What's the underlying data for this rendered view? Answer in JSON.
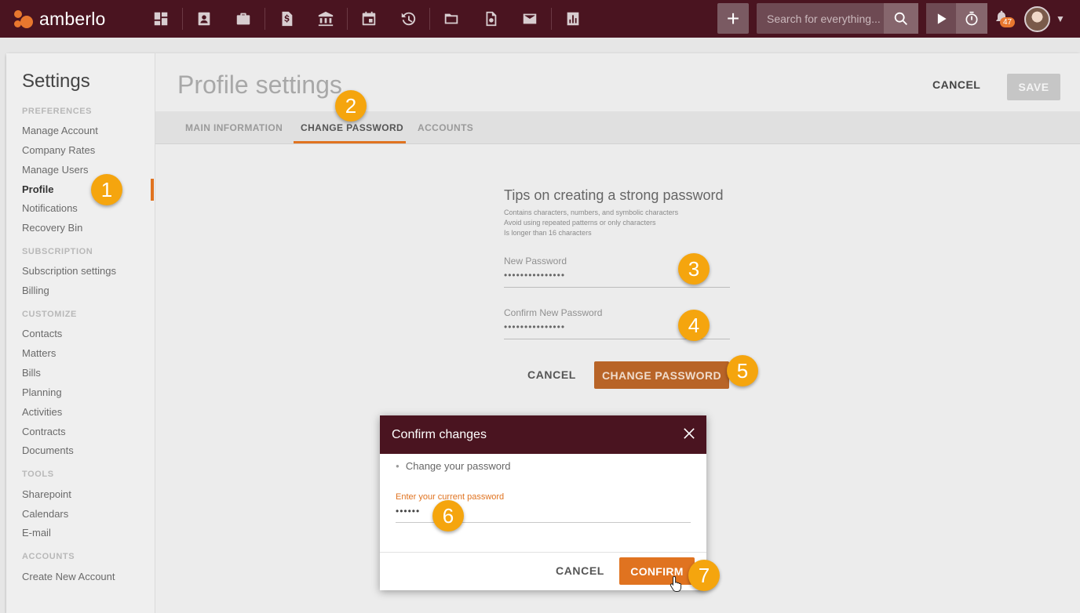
{
  "app": {
    "name": "amberlo"
  },
  "topbar": {
    "nav_icons": [
      "dashboard-icon",
      "contacts-icon",
      "matters-icon",
      "bills-icon",
      "bank-icon",
      "calendar-icon",
      "time-history-icon",
      "folder-icon",
      "document-settings-icon",
      "mail-icon",
      "reports-icon"
    ],
    "add_label": "+",
    "search_placeholder": "Search for everything...",
    "notifications_count": "47"
  },
  "sidebar": {
    "title": "Settings",
    "sections": [
      {
        "label": "PREFERENCES",
        "items": [
          "Manage Account",
          "Company Rates",
          "Manage Users",
          "Profile",
          "Notifications",
          "Recovery Bin"
        ]
      },
      {
        "label": "SUBSCRIPTION",
        "items": [
          "Subscription settings",
          "Billing"
        ]
      },
      {
        "label": "CUSTOMIZE",
        "items": [
          "Contacts",
          "Matters",
          "Bills",
          "Planning",
          "Activities",
          "Contracts",
          "Documents"
        ]
      },
      {
        "label": "TOOLS",
        "items": [
          "Sharepoint",
          "Calendars",
          "E-mail"
        ]
      },
      {
        "label": "ACCOUNTS",
        "items": [
          "Create New Account"
        ]
      }
    ],
    "active_item": "Profile"
  },
  "header": {
    "title": "Profile settings",
    "cancel_label": "CANCEL",
    "save_label": "SAVE"
  },
  "tabs": [
    {
      "label": "MAIN INFORMATION",
      "active": false
    },
    {
      "label": "CHANGE PASSWORD",
      "active": true
    },
    {
      "label": "ACCOUNTS",
      "active": false
    }
  ],
  "password_form": {
    "tips_title": "Tips on creating a strong password",
    "tips": [
      "Contains characters, numbers, and symbolic characters",
      "Avoid using repeated patterns or only characters",
      "Is longer than 16 characters"
    ],
    "new_password_label": "New Password",
    "new_password_value": "•••••••••••••••",
    "confirm_password_label": "Confirm New Password",
    "confirm_password_value": "•••••••••••••••",
    "cancel_label": "CANCEL",
    "submit_label": "CHANGE PASSWORD"
  },
  "modal": {
    "title": "Confirm changes",
    "bullet": "Change your password",
    "current_password_label": "Enter your current password",
    "current_password_value": "••••••",
    "cancel_label": "CANCEL",
    "confirm_label": "CONFIRM"
  },
  "markers": [
    "1",
    "2",
    "3",
    "4",
    "5",
    "6",
    "7"
  ],
  "colors": {
    "topbar": "#4a1420",
    "accent": "#e07320",
    "marker": "#f5a50e"
  }
}
